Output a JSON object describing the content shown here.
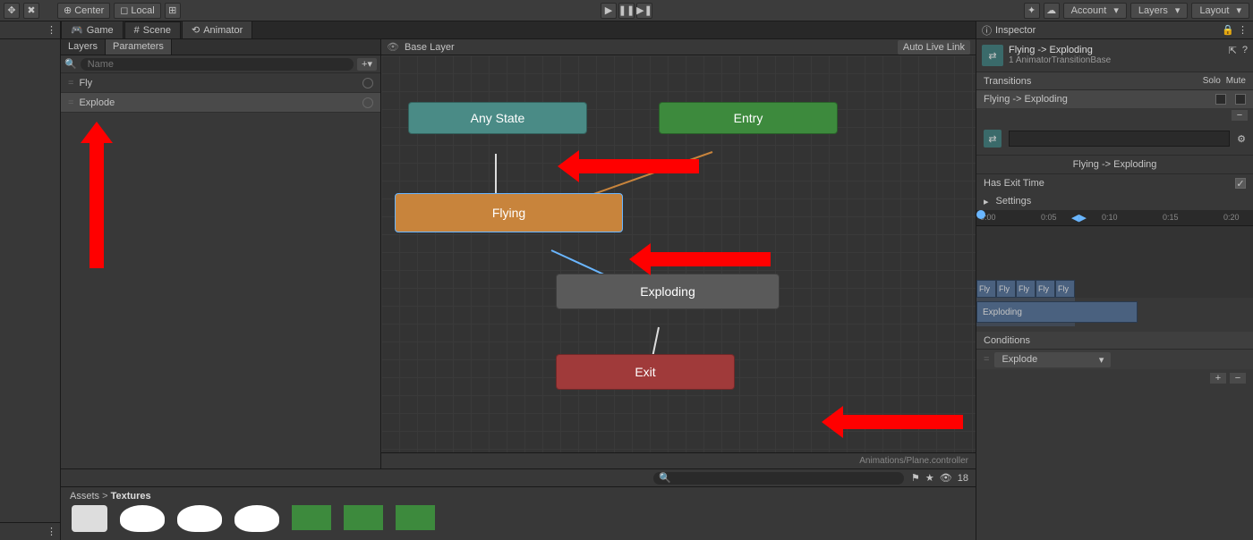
{
  "toolbar": {
    "pivot": "Center",
    "space": "Local",
    "account": "Account",
    "layers": "Layers",
    "layout": "Layout"
  },
  "tabs": {
    "game": "Game",
    "scene": "Scene",
    "animator": "Animator"
  },
  "params_panel": {
    "tabs": {
      "layers": "Layers",
      "parameters": "Parameters"
    },
    "search_placeholder": "Name",
    "items": [
      "Fly",
      "Explode"
    ]
  },
  "graph": {
    "breadcrumb": "Base Layer",
    "auto_live": "Auto Live Link",
    "nodes": {
      "any_state": "Any State",
      "entry": "Entry",
      "flying": "Flying",
      "exploding": "Exploding",
      "exit": "Exit"
    },
    "footer": "Animations/Plane.controller"
  },
  "bottom": {
    "count": "18",
    "assets_crumb_root": "Assets",
    "assets_crumb_current": "Textures"
  },
  "inspector": {
    "title": "Inspector",
    "transition_name": "Flying -> Exploding",
    "subtitle": "1 AnimatorTransitionBase",
    "transitions_hdr": "Transitions",
    "solo": "Solo",
    "mute": "Mute",
    "list_item": "Flying -> Exploding",
    "preview_label": "Flying -> Exploding",
    "has_exit_time": "Has Exit Time",
    "has_exit_time_checked": true,
    "settings": "Settings",
    "timeline_ticks": [
      "0:00",
      "0:05",
      "0:10",
      "0:15",
      "0:20"
    ],
    "clips": {
      "fly": "Fly",
      "exploding": "Exploding"
    },
    "conditions_hdr": "Conditions",
    "condition_param": "Explode"
  }
}
